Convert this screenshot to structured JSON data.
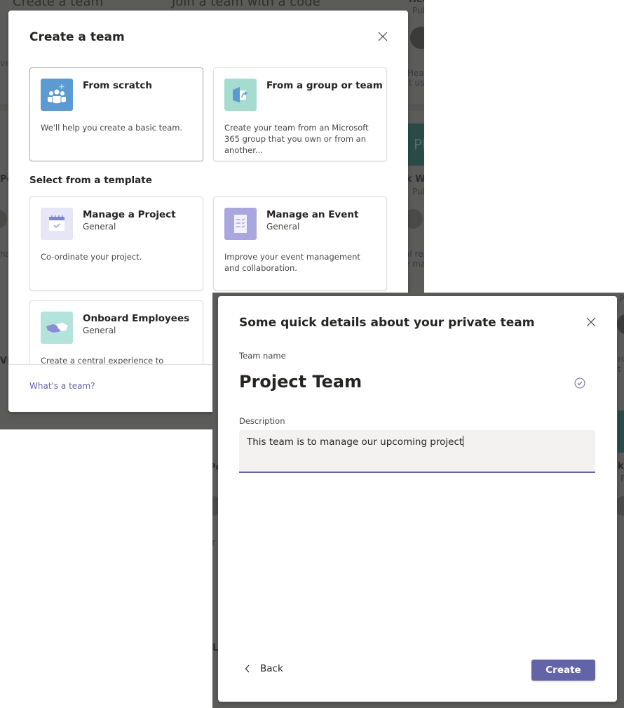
{
  "background": {
    "left_tabs": [
      "Create a team",
      "Join a team with a code"
    ],
    "left_fragments": [
      "Health a",
      "Pub",
      "Healt",
      "t use",
      "Pl",
      "k W",
      "Pub",
      "al rep",
      "e ma",
      "Po",
      "har",
      "VL",
      "ver"
    ],
    "right_fragments": [
      "Po",
      "ar",
      "L",
      "P",
      "He",
      "t u",
      "k",
      "P"
    ]
  },
  "create_dialog": {
    "title": "Create a team",
    "close_label": "Close",
    "options": [
      {
        "title": "From scratch",
        "description": "We'll help you create a basic team.",
        "icon": "people-add-icon",
        "icon_bg": "#5b9bd1"
      },
      {
        "title": "From a group or team",
        "description": "Create your team from an Microsoft 365 group that you own or from an another...",
        "icon": "group-export-icon",
        "icon_bg": "#a6dcd0"
      }
    ],
    "template_section_label": "Select from a template",
    "templates": [
      {
        "title": "Manage a Project",
        "category": "General",
        "description": "Co-ordinate your project.",
        "icon": "calendar-check-icon",
        "icon_bg": "#e6e6f7"
      },
      {
        "title": "Manage an Event",
        "category": "General",
        "description": "Improve your event management and collaboration.",
        "icon": "checklist-icon",
        "icon_bg": "#a9a8de"
      },
      {
        "title": "Onboard Employees",
        "category": "General",
        "description": "Create a central experience to onboard",
        "icon": "handshake-icon",
        "icon_bg": "#b4e3dc"
      }
    ],
    "footer_link": "What's a team?"
  },
  "details_dialog": {
    "title": "Some quick details about your private team",
    "team_name_label": "Team name",
    "team_name_value": "Project Team",
    "description_label": "Description",
    "description_value": "This team is to manage our upcoming project",
    "back_label": "Back",
    "create_label": "Create"
  },
  "colors": {
    "accent": "#6264a7",
    "overlay": "#5b5b5a"
  }
}
